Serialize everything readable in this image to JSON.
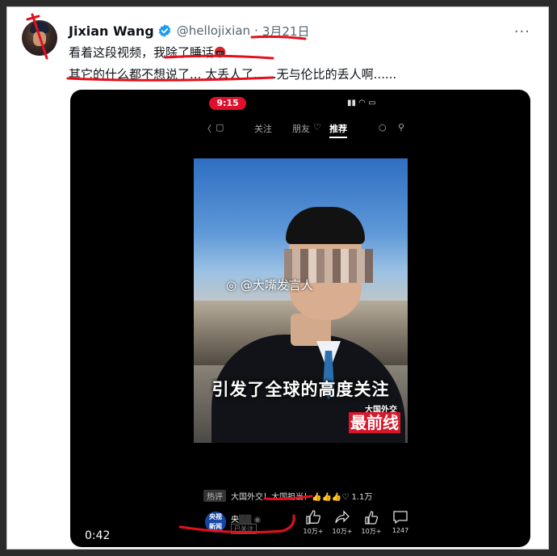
{
  "tweet": {
    "author_name": "Jixian Wang",
    "handle": "@hellojixian",
    "separator": "·",
    "date": "3月21日",
    "more_label": "···",
    "text_line1": "看着这段视频，我除了睡话",
    "text_line2": "其它的什么都不想说了... 太丢人了......无与伦比的丢人啊......",
    "emoji": "angry-face-with-symbols-icon"
  },
  "video": {
    "duration": "0:42",
    "phone": {
      "status_time": "9:15",
      "status_icons": "▮▮ ◠ ▭",
      "nav_follow": "关注",
      "nav_friends": "朋友",
      "nav_recommend": "推荐"
    },
    "watermark": "@大嘴发言人",
    "caption": "引发了全球的高度关注",
    "logo_line1": "大国外交",
    "logo_line2": "最前线",
    "hot_tag": "热评",
    "hot_comment": "大国外交！大国担当！👍👍👍♡ 1.1万",
    "account_logo_top": "央视",
    "account_logo_bottom": "新闻",
    "account_name": "央",
    "account_sub": "已关注",
    "actions": [
      {
        "icon": "thumb-up-icon",
        "count": "10万+"
      },
      {
        "icon": "share-icon",
        "count": "10万+"
      },
      {
        "icon": "like-icon",
        "count": "10万+"
      },
      {
        "icon": "comment-icon",
        "count": "1247"
      }
    ]
  },
  "colors": {
    "annotation_red": "#e3101e",
    "verified_blue": "#1d9bf0",
    "status_red": "#e0102a"
  }
}
